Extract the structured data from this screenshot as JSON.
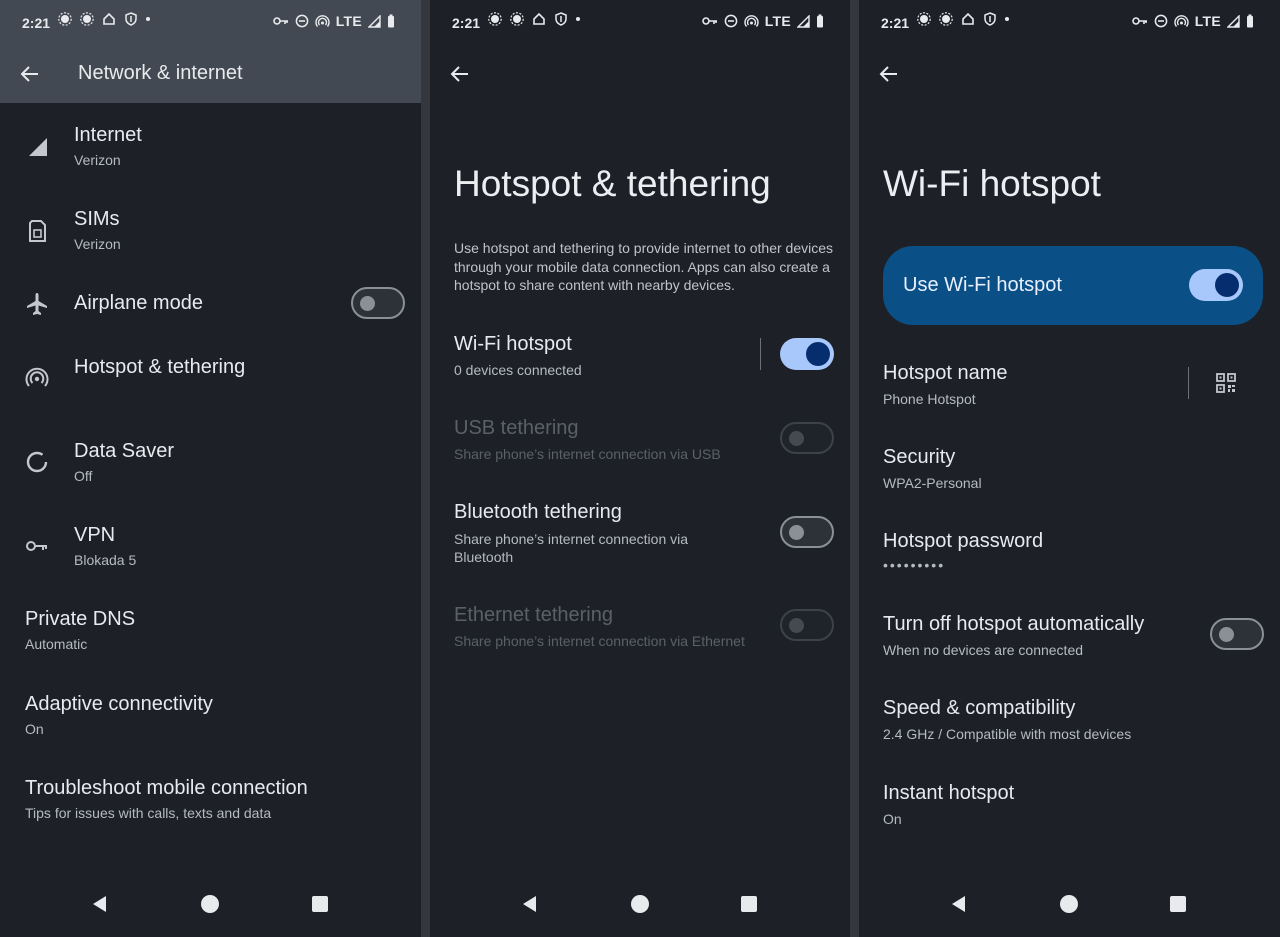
{
  "status_bar": {
    "time": "2:21",
    "network": "LTE"
  },
  "panel1": {
    "title": "Network & internet",
    "items": [
      {
        "title": "Internet",
        "subtitle": "Verizon"
      },
      {
        "title": "SIMs",
        "subtitle": "Verizon"
      },
      {
        "title": "Airplane mode",
        "toggle": "off"
      },
      {
        "title": "Hotspot & tethering"
      },
      {
        "title": "Data Saver",
        "subtitle": "Off"
      },
      {
        "title": "VPN",
        "subtitle": "Blokada 5"
      },
      {
        "title": "Private DNS",
        "subtitle": "Automatic"
      },
      {
        "title": "Adaptive connectivity",
        "subtitle": "On"
      },
      {
        "title": "Troubleshoot mobile connection",
        "subtitle": "Tips for issues with calls, texts and data"
      }
    ]
  },
  "panel2": {
    "title": "Hotspot & tethering",
    "description": "Use hotspot and tethering to provide internet to other devices through your mobile data connection. Apps can also create a hotspot to share content with nearby devices.",
    "items": [
      {
        "title": "Wi-Fi hotspot",
        "subtitle": "0 devices connected",
        "toggle": "on"
      },
      {
        "title": "USB tethering",
        "subtitle": "Share phone’s internet connection via USB",
        "toggle": "disabled"
      },
      {
        "title": "Bluetooth tethering",
        "subtitle": "Share phone’s internet connection via Bluetooth",
        "toggle": "off"
      },
      {
        "title": "Ethernet tethering",
        "subtitle": "Share phone’s internet connection via Ethernet",
        "toggle": "disabled"
      }
    ]
  },
  "panel3": {
    "title": "Wi-Fi hotspot",
    "use_hotspot_label": "Use Wi-Fi hotspot",
    "use_hotspot_toggle": "on",
    "items": [
      {
        "title": "Hotspot name",
        "subtitle": "Phone Hotspot"
      },
      {
        "title": "Security",
        "subtitle": "WPA2-Personal"
      },
      {
        "title": "Hotspot password",
        "subtitle": "•••••••••"
      },
      {
        "title": "Turn off hotspot automatically",
        "subtitle": "When no devices are connected",
        "toggle": "off"
      },
      {
        "title": "Speed & compatibility",
        "subtitle": "2.4 GHz / Compatible with most devices"
      },
      {
        "title": "Instant hotspot",
        "subtitle": "On"
      }
    ]
  },
  "colors": {
    "background": "#1d2127",
    "accent": "#a8c7fa",
    "card": "#0a4f86",
    "header": "#434952"
  }
}
